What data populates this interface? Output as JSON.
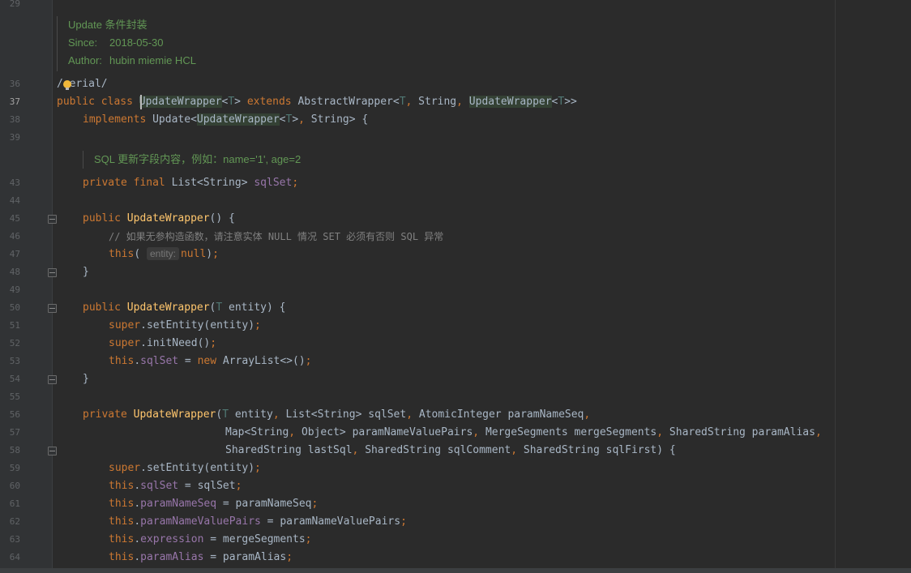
{
  "editor": {
    "theme": {
      "background": "#2b2b2b",
      "gutter": "#313335",
      "keyword": "#cc7832",
      "method": "#ffc66d",
      "field": "#9876aa",
      "type_param": "#507874",
      "comment": "#808080",
      "doc": "#629755",
      "text": "#a9b7c6"
    },
    "lines": {
      "l29": "29",
      "l36": "36",
      "l37": "37",
      "l38": "38",
      "l39": "39",
      "l43": "43",
      "l44": "44",
      "l45": "45",
      "l46": "46",
      "l47": "47",
      "l48": "48",
      "l49": "49",
      "l50": "50",
      "l51": "51",
      "l52": "52",
      "l53": "53",
      "l54": "54",
      "l55": "55",
      "l56": "56",
      "l57": "57",
      "l58": "58",
      "l59": "59",
      "l60": "60",
      "l61": "61",
      "l62": "62",
      "l63": "63",
      "l64": "64"
    },
    "doc_class": {
      "line1": "Update 条件封装",
      "since_label": "Since:",
      "since_value": "2018-05-30",
      "author_label": "Author:",
      "author_value": "hubin miemie HCL"
    },
    "doc_field": {
      "line1": "SQL 更新字段内容，例如：name='1', age=2"
    },
    "code": {
      "serial": "/serial/",
      "public": "public",
      "class": "class",
      "class_name": "UpdateWrapper",
      "type_param": "T",
      "extends": "extends",
      "abstract_wrapper": "AbstractWrapper",
      "string": "String",
      "implements": "implements",
      "update": "Update",
      "brace_open": "{",
      "private": "private",
      "final": "final",
      "list": "List",
      "sql_set": "sqlSet",
      "comment_46": "// 如果无参构造函数，请注意实体 NULL 情况 SET 必须有否则 SQL 异常",
      "this": "this",
      "hint_entity": "entity:",
      "null": "null",
      "entity": "entity",
      "super": "super",
      "set_entity": "setEntity",
      "init_need": "initNeed",
      "new": "new",
      "array_list": "ArrayList",
      "atomic_integer": "AtomicInteger",
      "param_name_seq": "paramNameSeq",
      "map": "Map",
      "object": "Object",
      "param_name_value_pairs": "paramNameValuePairs",
      "merge_segments_type": "MergeSegments",
      "merge_segments": "mergeSegments",
      "shared_string": "SharedString",
      "param_alias": "paramAlias",
      "last_sql": "lastSql",
      "sql_comment": "sqlComment",
      "sql_first": "sqlFirst",
      "expression": "expression"
    }
  }
}
